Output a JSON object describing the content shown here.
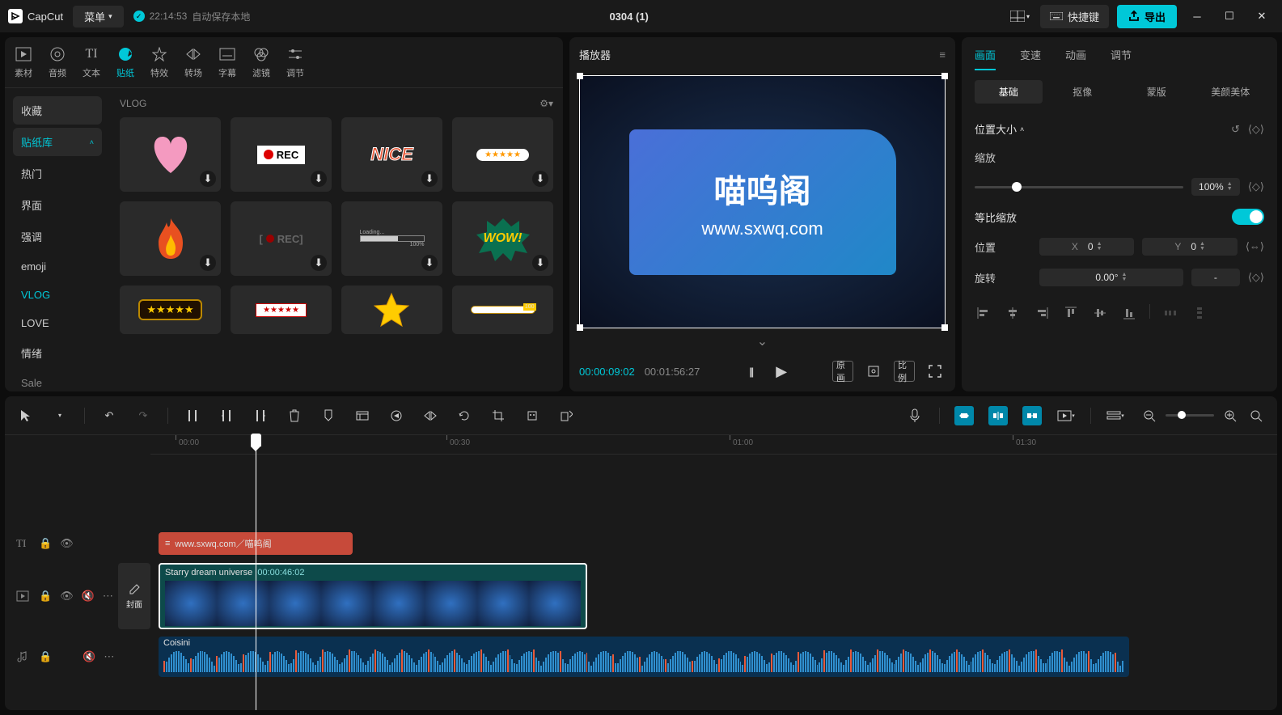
{
  "titlebar": {
    "logo": "CapCut",
    "menu": "菜单",
    "autosave_time": "22:14:53",
    "autosave_text": "自动保存本地",
    "title": "0304 (1)",
    "shortcut": "快捷键",
    "export": "导出"
  },
  "top_tabs": [
    {
      "icon": "media",
      "label": "素材"
    },
    {
      "icon": "audio",
      "label": "音频"
    },
    {
      "icon": "text",
      "label": "文本"
    },
    {
      "icon": "sticker",
      "label": "贴纸",
      "active": true
    },
    {
      "icon": "effect",
      "label": "特效"
    },
    {
      "icon": "transition",
      "label": "转场"
    },
    {
      "icon": "caption",
      "label": "字幕"
    },
    {
      "icon": "filter",
      "label": "滤镜"
    },
    {
      "icon": "adjust",
      "label": "调节"
    }
  ],
  "sidebar": {
    "collection": "收藏",
    "library": "贴纸库",
    "items": [
      "热门",
      "界面",
      "强调",
      "emoji",
      "VLOG",
      "LOVE",
      "情绪",
      "Sale"
    ]
  },
  "sticker_section": "VLOG",
  "player": {
    "label": "播放器",
    "banner_title": "喵呜阁",
    "banner_url": "www.sxwq.com",
    "time_current": "00:00:09:02",
    "time_total": "00:01:56:27",
    "original": "原画",
    "ratio": "比例"
  },
  "right": {
    "tabs": [
      "画面",
      "变速",
      "动画",
      "调节"
    ],
    "subtabs": [
      "基础",
      "抠像",
      "蒙版",
      "美颜美体"
    ],
    "position_size": "位置大小",
    "scale": "缩放",
    "scale_value": "100%",
    "prop_scale": "等比缩放",
    "position": "位置",
    "x_label": "X",
    "x_value": "0",
    "y_label": "Y",
    "y_value": "0",
    "rotation": "旋转",
    "rotation_value": "0.00°",
    "dash": "-"
  },
  "ruler": [
    "00:00",
    "00:30",
    "01:00",
    "01:30"
  ],
  "tracks": {
    "text_clip": "www.sxwq.com／喵呜阁",
    "video_name": "Starry dream universe",
    "video_dur": "00:00:46:02",
    "cover": "封面",
    "audio_name": "Coisini"
  }
}
